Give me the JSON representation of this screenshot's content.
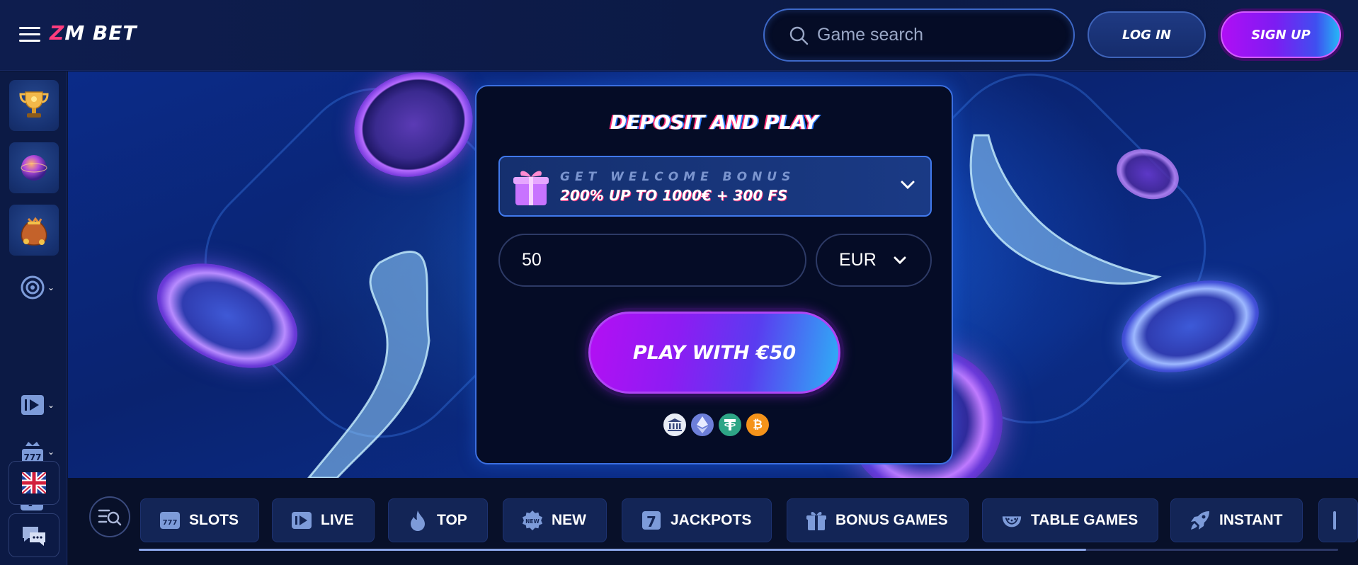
{
  "header": {
    "logo_text": "ZM BET",
    "search": {
      "placeholder": "Game search"
    },
    "login_label": "LOG IN",
    "signup_label": "SIGN UP"
  },
  "sidebar": {
    "items": [
      {
        "icon": "trophy-icon"
      },
      {
        "icon": "globe-orb-icon"
      },
      {
        "icon": "treasure-bag-icon"
      },
      {
        "icon": "roulette-icon",
        "expandable": true
      },
      {
        "icon": "live-play-icon",
        "expandable": true
      },
      {
        "icon": "slot-777-icon",
        "expandable": true
      },
      {
        "icon": "seven-jackpot-icon"
      },
      {
        "icon": "uk-flag-icon"
      },
      {
        "icon": "chat-icon"
      }
    ]
  },
  "deposit": {
    "title": "DEPOSIT AND PLAY",
    "bonus_kicker": "GET WELCOME BONUS",
    "bonus_offer": "200% UP TO 1000€ + 300 FS",
    "amount_value": "50",
    "currency": "EUR",
    "play_label": "PLAY WITH €50",
    "payment_methods": [
      {
        "name": "bank-icon",
        "color": "#e9edf5"
      },
      {
        "name": "ethereum-icon",
        "color": "#6d7fd9"
      },
      {
        "name": "tether-icon",
        "color": "#2ea586"
      },
      {
        "name": "bitcoin-icon",
        "color": "#f5931a"
      }
    ]
  },
  "categories": {
    "items": [
      {
        "label": "SLOTS",
        "icon": "slot-777-icon"
      },
      {
        "label": "LIVE",
        "icon": "live-play-icon"
      },
      {
        "label": "TOP",
        "icon": "flame-icon"
      },
      {
        "label": "NEW",
        "icon": "new-badge-icon"
      },
      {
        "label": "JACKPOTS",
        "icon": "seven-jackpot-icon"
      },
      {
        "label": "BONUS GAMES",
        "icon": "gift-icon"
      },
      {
        "label": "TABLE GAMES",
        "icon": "table-games-icon"
      },
      {
        "label": "INSTANT",
        "icon": "rocket-icon"
      }
    ],
    "scroll_progress": 0.79
  },
  "colors": {
    "accent_purple": "#b00ef5",
    "accent_blue": "#25b7f6",
    "background": "#0a1434",
    "card_border": "#3c6fe0"
  }
}
